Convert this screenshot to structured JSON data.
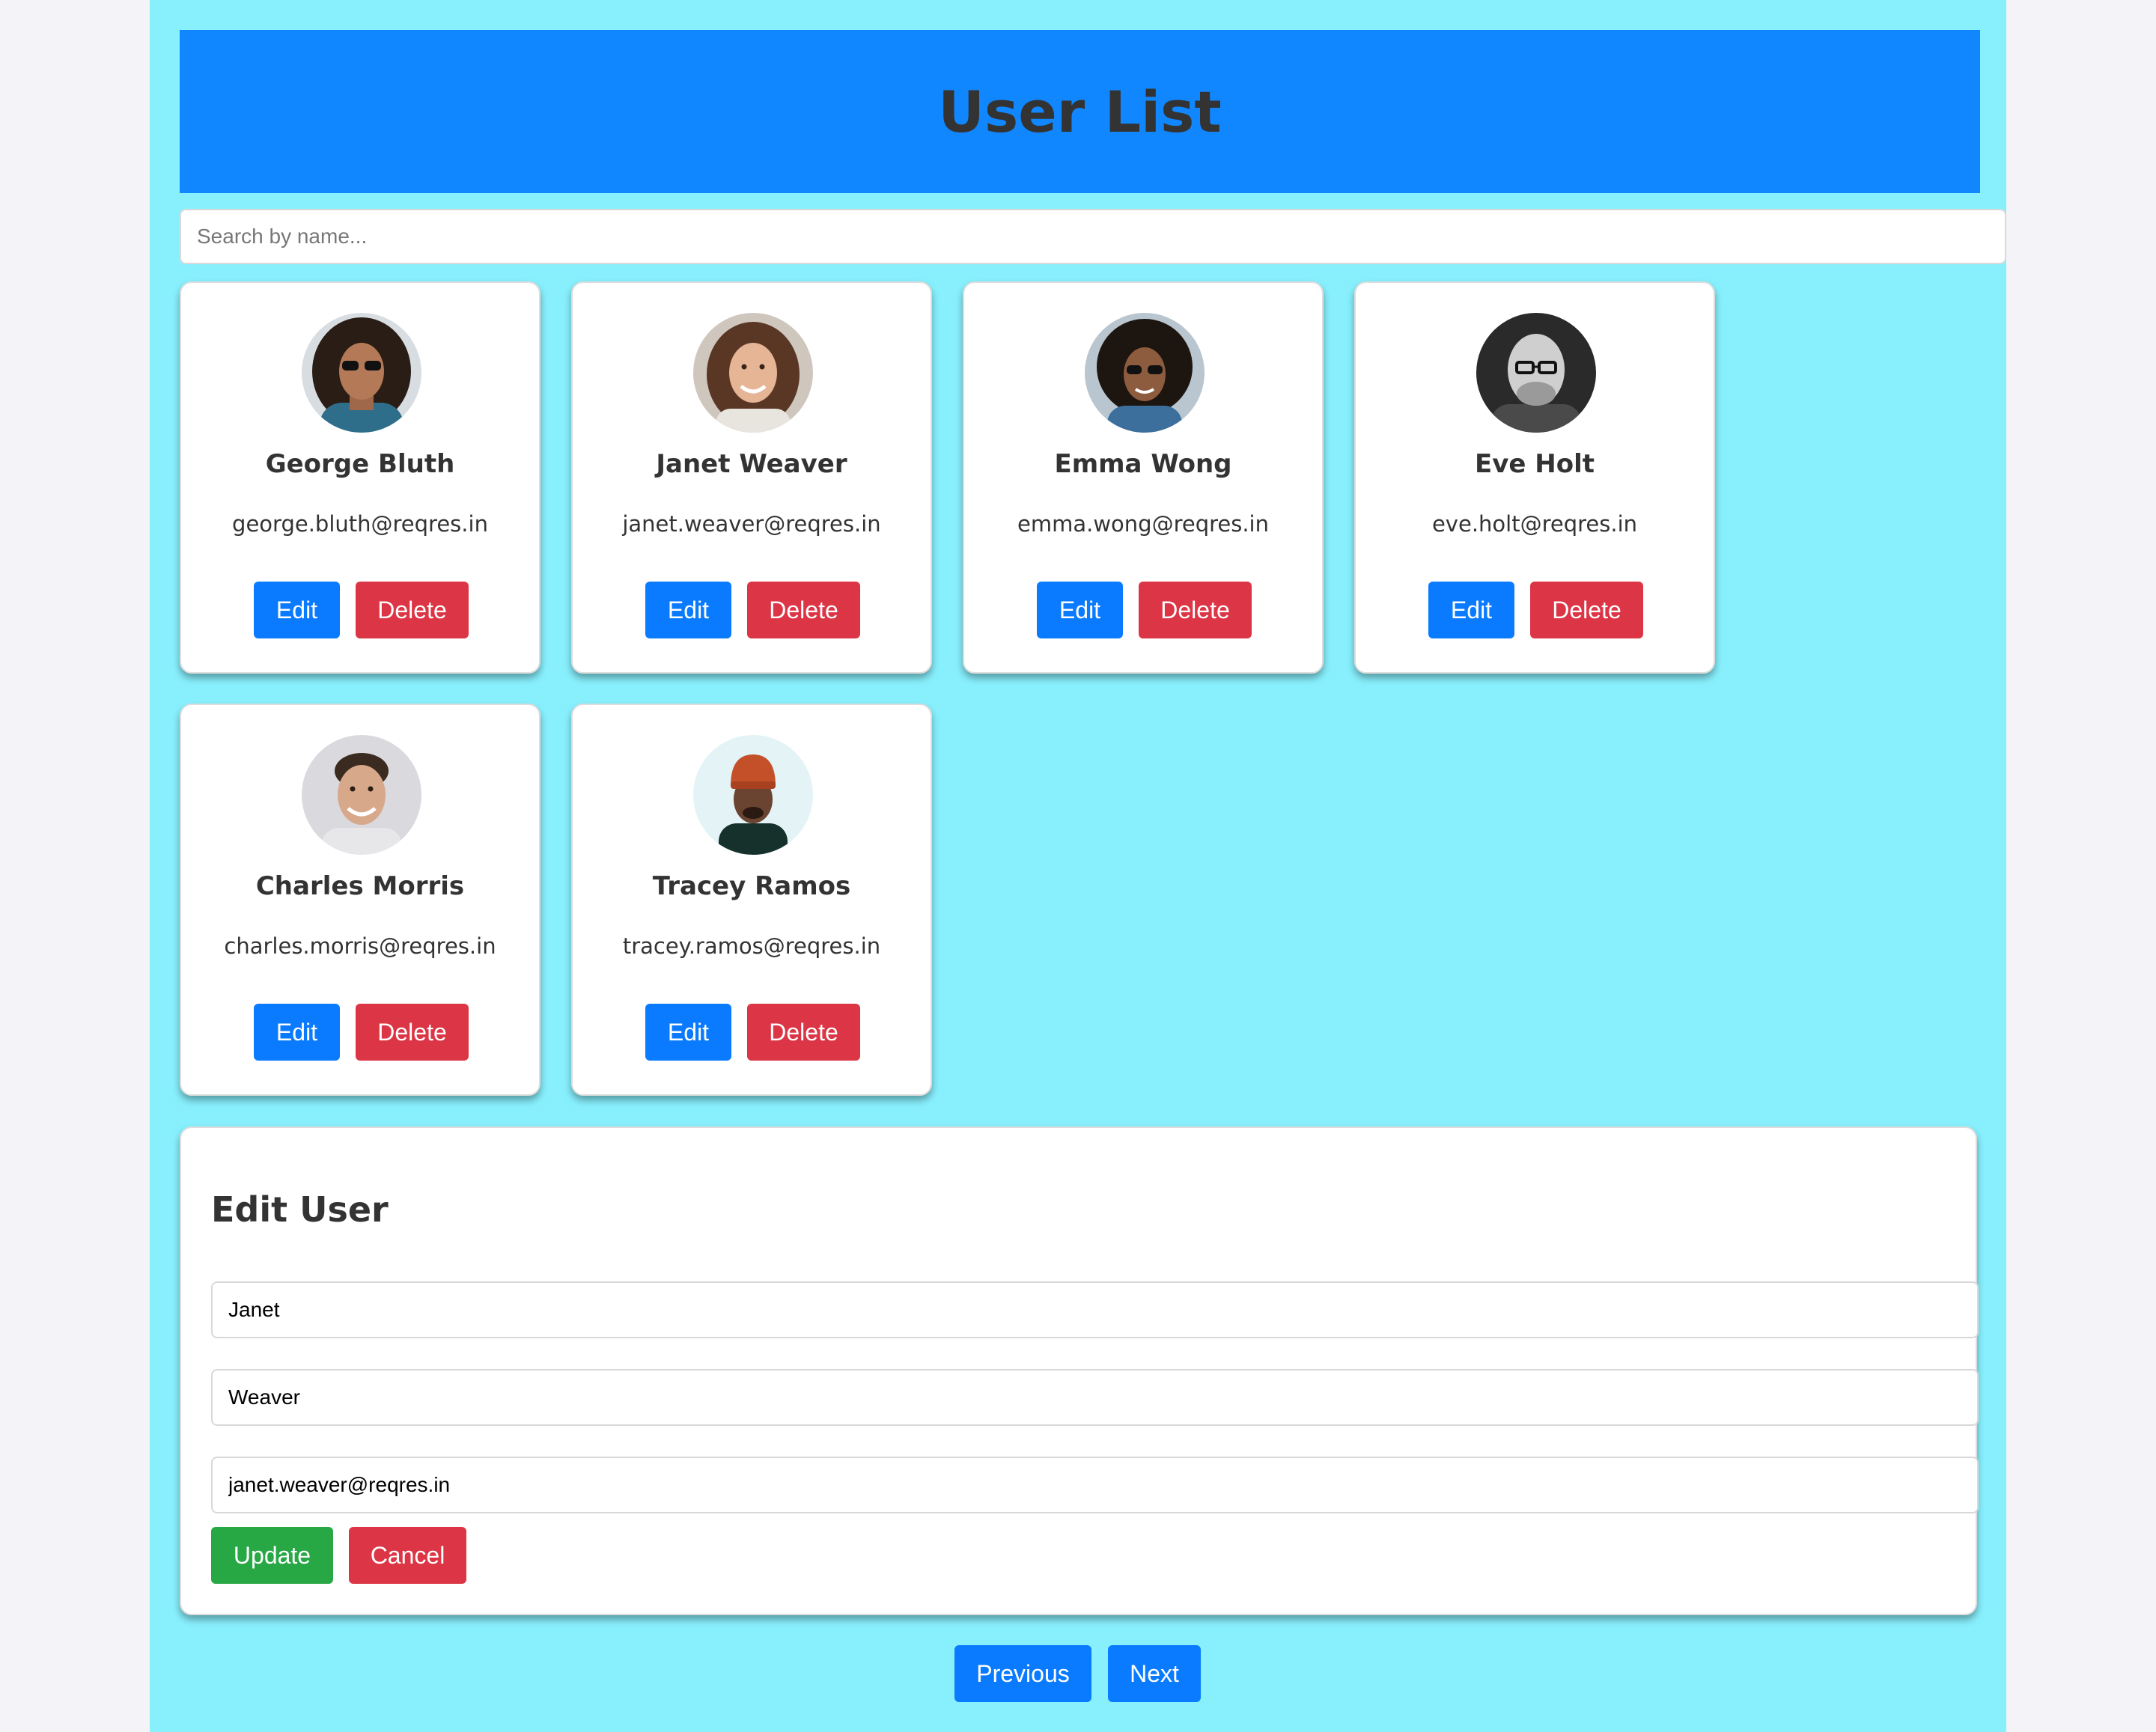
{
  "header": {
    "title": "User List"
  },
  "search": {
    "placeholder": "Search by name...",
    "value": ""
  },
  "users": [
    {
      "name": "George Bluth",
      "email": "george.bluth@reqres.in",
      "edit_label": "Edit",
      "delete_label": "Delete"
    },
    {
      "name": "Janet Weaver",
      "email": "janet.weaver@reqres.in",
      "edit_label": "Edit",
      "delete_label": "Delete"
    },
    {
      "name": "Emma Wong",
      "email": "emma.wong@reqres.in",
      "edit_label": "Edit",
      "delete_label": "Delete"
    },
    {
      "name": "Eve Holt",
      "email": "eve.holt@reqres.in",
      "edit_label": "Edit",
      "delete_label": "Delete"
    },
    {
      "name": "Charles Morris",
      "email": "charles.morris@reqres.in",
      "edit_label": "Edit",
      "delete_label": "Delete"
    },
    {
      "name": "Tracey Ramos",
      "email": "tracey.ramos@reqres.in",
      "edit_label": "Edit",
      "delete_label": "Delete"
    }
  ],
  "edit_form": {
    "title": "Edit User",
    "first_name": "Janet",
    "last_name": "Weaver",
    "email": "janet.weaver@reqres.in",
    "update_label": "Update",
    "cancel_label": "Cancel"
  },
  "pagination": {
    "previous_label": "Previous",
    "next_label": "Next"
  },
  "colors": {
    "page_background": "#88f0fd",
    "header_background": "#1187ff",
    "primary_button": "#0a7bff",
    "danger_button": "#dc3545",
    "success_button": "#28a745"
  }
}
